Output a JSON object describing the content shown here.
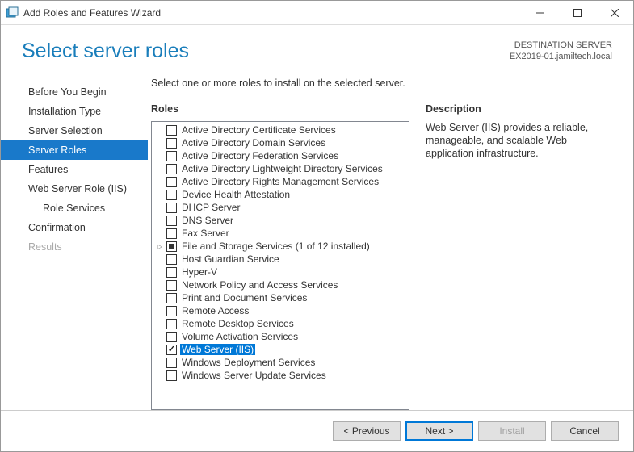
{
  "window": {
    "title": "Add Roles and Features Wizard"
  },
  "header": {
    "title": "Select server roles",
    "dest_label": "DESTINATION SERVER",
    "dest_value": "EX2019-01.jamiltech.local"
  },
  "sidebar": {
    "items": [
      {
        "label": "Before You Begin",
        "selected": false,
        "disabled": false,
        "sub": false
      },
      {
        "label": "Installation Type",
        "selected": false,
        "disabled": false,
        "sub": false
      },
      {
        "label": "Server Selection",
        "selected": false,
        "disabled": false,
        "sub": false
      },
      {
        "label": "Server Roles",
        "selected": true,
        "disabled": false,
        "sub": false
      },
      {
        "label": "Features",
        "selected": false,
        "disabled": false,
        "sub": false
      },
      {
        "label": "Web Server Role (IIS)",
        "selected": false,
        "disabled": false,
        "sub": false
      },
      {
        "label": "Role Services",
        "selected": false,
        "disabled": false,
        "sub": true
      },
      {
        "label": "Confirmation",
        "selected": false,
        "disabled": false,
        "sub": false
      },
      {
        "label": "Results",
        "selected": false,
        "disabled": true,
        "sub": false
      }
    ]
  },
  "main": {
    "instruction": "Select one or more roles to install on the selected server.",
    "roles_heading": "Roles",
    "desc_heading": "Description",
    "description": "Web Server (IIS) provides a reliable, manageable, and scalable Web application infrastructure.",
    "roles": [
      {
        "label": "Active Directory Certificate Services",
        "checked": false,
        "partial": false,
        "expander": "",
        "selected": false
      },
      {
        "label": "Active Directory Domain Services",
        "checked": false,
        "partial": false,
        "expander": "",
        "selected": false
      },
      {
        "label": "Active Directory Federation Services",
        "checked": false,
        "partial": false,
        "expander": "",
        "selected": false
      },
      {
        "label": "Active Directory Lightweight Directory Services",
        "checked": false,
        "partial": false,
        "expander": "",
        "selected": false
      },
      {
        "label": "Active Directory Rights Management Services",
        "checked": false,
        "partial": false,
        "expander": "",
        "selected": false
      },
      {
        "label": "Device Health Attestation",
        "checked": false,
        "partial": false,
        "expander": "",
        "selected": false
      },
      {
        "label": "DHCP Server",
        "checked": false,
        "partial": false,
        "expander": "",
        "selected": false
      },
      {
        "label": "DNS Server",
        "checked": false,
        "partial": false,
        "expander": "",
        "selected": false
      },
      {
        "label": "Fax Server",
        "checked": false,
        "partial": false,
        "expander": "",
        "selected": false
      },
      {
        "label": "File and Storage Services (1 of 12 installed)",
        "checked": false,
        "partial": true,
        "expander": "▷",
        "selected": false
      },
      {
        "label": "Host Guardian Service",
        "checked": false,
        "partial": false,
        "expander": "",
        "selected": false
      },
      {
        "label": "Hyper-V",
        "checked": false,
        "partial": false,
        "expander": "",
        "selected": false
      },
      {
        "label": "Network Policy and Access Services",
        "checked": false,
        "partial": false,
        "expander": "",
        "selected": false
      },
      {
        "label": "Print and Document Services",
        "checked": false,
        "partial": false,
        "expander": "",
        "selected": false
      },
      {
        "label": "Remote Access",
        "checked": false,
        "partial": false,
        "expander": "",
        "selected": false
      },
      {
        "label": "Remote Desktop Services",
        "checked": false,
        "partial": false,
        "expander": "",
        "selected": false
      },
      {
        "label": "Volume Activation Services",
        "checked": false,
        "partial": false,
        "expander": "",
        "selected": false
      },
      {
        "label": "Web Server (IIS)",
        "checked": true,
        "partial": false,
        "expander": "",
        "selected": true
      },
      {
        "label": "Windows Deployment Services",
        "checked": false,
        "partial": false,
        "expander": "",
        "selected": false
      },
      {
        "label": "Windows Server Update Services",
        "checked": false,
        "partial": false,
        "expander": "",
        "selected": false
      }
    ]
  },
  "footer": {
    "previous": "< Previous",
    "next": "Next >",
    "install": "Install",
    "cancel": "Cancel"
  }
}
